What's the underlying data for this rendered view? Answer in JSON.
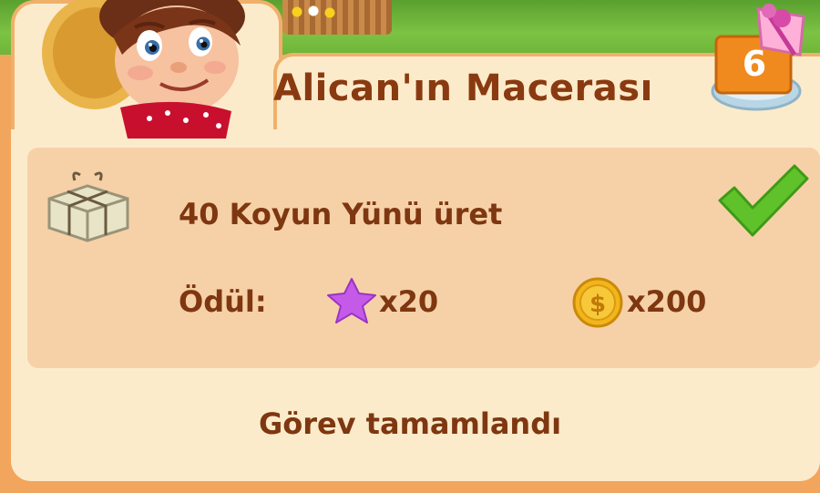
{
  "quest": {
    "title": "Alican'ın Macerası",
    "level": "6",
    "task": "40 Koyun Yünü üret",
    "reward_label": "Ödül:",
    "rewards": [
      {
        "icon": "purple-star-icon",
        "amount": "x20"
      },
      {
        "icon": "gold-coin-icon",
        "amount": "x200"
      }
    ],
    "status": "Görev tamamlandı",
    "completed": true
  },
  "colors": {
    "title_text": "#8a3a10",
    "body_text": "#7e3710",
    "panel_bg": "#fcebcb",
    "card_bg": "#f6d1a8",
    "outer_bg": "#f2a55c",
    "check_green": "#5fc22a"
  }
}
